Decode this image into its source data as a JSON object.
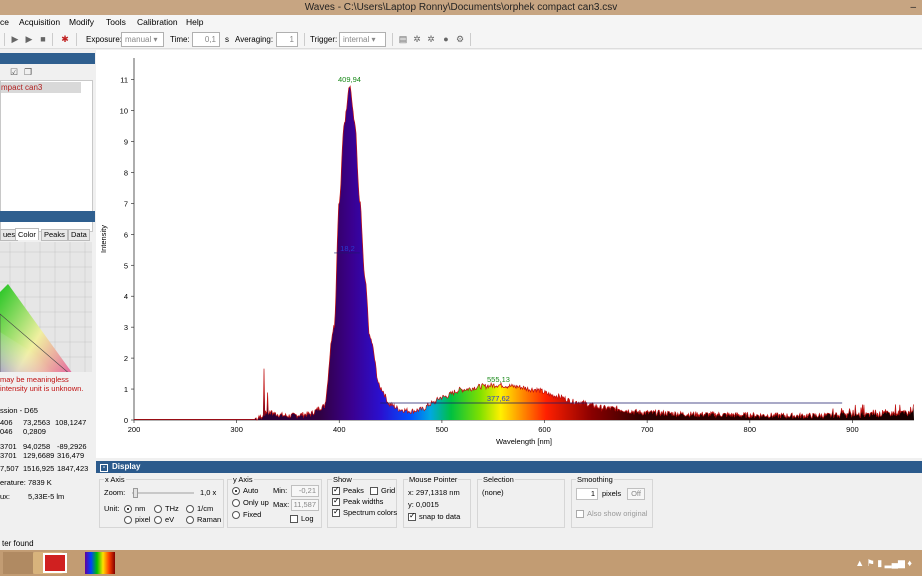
{
  "window": {
    "title": "Waves  -  C:\\Users\\Laptop Ronny\\Documents\\orphek compact can3.csv",
    "minimize": "–"
  },
  "menu": [
    "ce",
    "Acquisition",
    "Modify",
    "Tools",
    "Calibration",
    "Help"
  ],
  "toolbar": {
    "exposure_label": "Exposure:",
    "exposure_value": "manual",
    "time_label": "Time:",
    "time_value": "0,1",
    "time_unit": "s",
    "averaging_label": "Averaging:",
    "averaging_value": "1",
    "trigger_label": "Trigger:",
    "trigger_value": "internal"
  },
  "left_panel": {
    "file_item": "mpact can3",
    "tabs": [
      "ues",
      "Color",
      "Peaks",
      "Data"
    ],
    "warning": [
      "may be meaningless",
      "intensity unit is unknown."
    ],
    "illuminant": "ssion - D65",
    "rows": [
      [
        "406",
        "73,2563",
        "108,1247"
      ],
      [
        "046",
        "0,2809",
        ""
      ],
      [
        "3701",
        "94,0258",
        "-89,2926"
      ],
      [
        "3701",
        "129,6689",
        "316,479"
      ],
      [
        "7,507",
        "1516,925",
        "1847,423"
      ]
    ],
    "cct_label": "erature:",
    "cct_value": "7839 K",
    "lux_label": "ux:",
    "lux_value": "5,33E-5 lm"
  },
  "chart_data": {
    "type": "area",
    "xlabel": "Wavelength [nm]",
    "ylabel": "Intensity",
    "xlim": [
      200,
      960
    ],
    "ylim": [
      0,
      11.7
    ],
    "xticks": [
      200,
      300,
      400,
      500,
      600,
      700,
      800,
      900
    ],
    "yticks": [
      0,
      1,
      2,
      3,
      4,
      5,
      6,
      7,
      8,
      9,
      10,
      11
    ],
    "x": [
      200,
      320,
      330,
      350,
      370,
      385,
      395,
      400,
      405,
      410,
      415,
      420,
      425,
      430,
      440,
      450,
      460,
      470,
      480,
      490,
      500,
      520,
      540,
      555,
      570,
      590,
      610,
      630,
      660,
      700,
      750,
      800,
      850,
      900,
      960
    ],
    "y": [
      0.02,
      0.02,
      0.2,
      0.1,
      0.15,
      0.4,
      3.0,
      7.0,
      9.6,
      10.8,
      9.6,
      7.0,
      4.5,
      2.6,
      1.0,
      0.45,
      0.3,
      0.25,
      0.3,
      0.5,
      0.7,
      0.95,
      1.05,
      1.1,
      1.05,
      0.95,
      0.75,
      0.55,
      0.35,
      0.2,
      0.15,
      0.12,
      0.1,
      0.12,
      0.2
    ],
    "peak_labels": [
      {
        "x": 409.94,
        "y": 10.8,
        "text": "409,94"
      },
      {
        "x": 555.13,
        "y": 1.1,
        "text": "555,13"
      }
    ],
    "width_labels": [
      {
        "x": 408,
        "y": 5.4,
        "text": "18,2"
      },
      {
        "x": 555,
        "y": 0.55,
        "text": "377,62"
      }
    ],
    "width_line": {
      "x1": 395,
      "x2": 420,
      "y": 5.4
    },
    "width_line2": {
      "x1": 440,
      "x2": 890,
      "y": 0.55
    },
    "colors": {
      "peak_label": "#1a8a1a",
      "width_label": "#2a3ad0",
      "outline": "#c01010"
    }
  },
  "display": {
    "title": "Display",
    "xaxis": {
      "title": "x Axis",
      "zoom_label": "Zoom:",
      "zoom_value": "1,0 x",
      "unit_label": "Unit:",
      "units": [
        "nm",
        "THz",
        "1/cm",
        "pixel",
        "eV",
        "Raman"
      ]
    },
    "yaxis": {
      "title": "y Axis",
      "options": [
        "Auto",
        "Only up",
        "Fixed"
      ],
      "min_label": "Min:",
      "min_value": "-0,21",
      "max_label": "Max:",
      "max_value": "11,587",
      "log_label": "Log"
    },
    "show": {
      "title": "Show",
      "peaks": "Peaks",
      "grid": "Grid",
      "peak_widths": "Peak widths",
      "spectrum_colors": "Spectrum colors"
    },
    "mouse": {
      "title": "Mouse Pointer",
      "x": "x: 297,1318 nm",
      "y": "y: 0,0015",
      "snap": "snap to data"
    },
    "selection": {
      "title": "Selection",
      "value": "(none)"
    },
    "smoothing": {
      "title": "Smoothing",
      "value": "1",
      "unit": "pixels",
      "off": "Off",
      "also_show": "Also show original"
    }
  },
  "status": "ter found"
}
